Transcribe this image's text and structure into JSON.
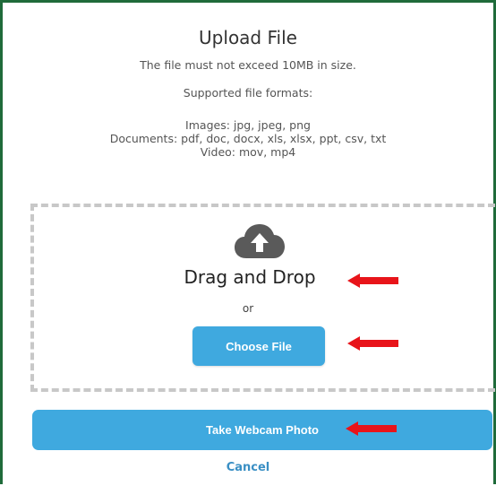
{
  "dialog": {
    "title": "Upload File",
    "size_limit": "The file must not exceed 10MB in size.",
    "supported_label": "Supported file formats:",
    "formats": {
      "images": "Images: jpg, jpeg, png",
      "documents": "Documents: pdf, doc, docx, xls, xlsx, ppt, csv, txt",
      "video": "Video: mov, mp4"
    }
  },
  "dropzone": {
    "icon": "cloud-upload-icon",
    "drag_text": "Drag and Drop",
    "or_text": "or",
    "choose_label": "Choose File"
  },
  "actions": {
    "webcam_label": "Take Webcam Photo",
    "cancel_label": "Cancel"
  },
  "colors": {
    "frame": "#1f6b3a",
    "button": "#3fa9df",
    "link": "#3a8fc4",
    "arrow": "#e8141a",
    "dash": "#c8c8c8"
  }
}
